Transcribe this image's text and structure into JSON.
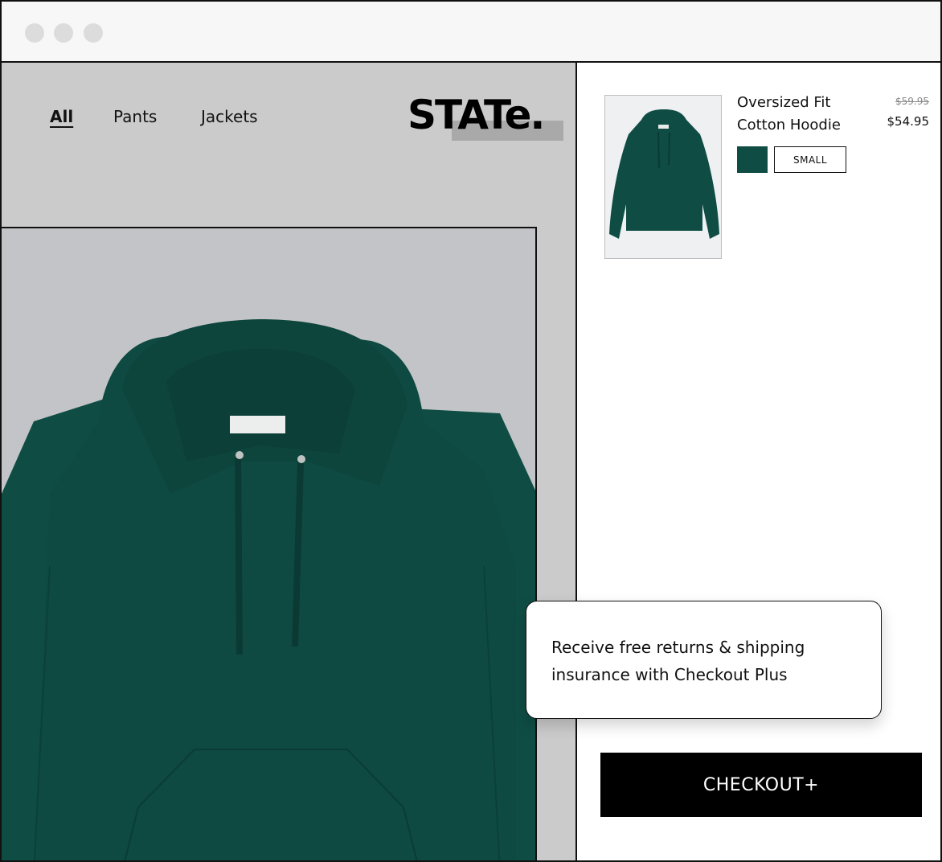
{
  "nav": {
    "items": [
      {
        "label": "All",
        "active": true
      },
      {
        "label": "Pants",
        "active": false
      },
      {
        "label": "Jackets",
        "active": false
      }
    ]
  },
  "brand": {
    "logo_text": "STATe."
  },
  "cart": {
    "item": {
      "name": "Oversized Fit Cotton Hoodie",
      "original_price": "$59.95",
      "price": "$54.95",
      "color": "#0f4d44",
      "size": "SMALL"
    },
    "checkout_label": "CHECKOUT+"
  },
  "promo": {
    "text": "Receive free returns & shipping insurance with Checkout Plus"
  },
  "colors": {
    "hoodie": "#0f4d44",
    "store_bg": "#cbcbcb",
    "button": "#000000"
  }
}
